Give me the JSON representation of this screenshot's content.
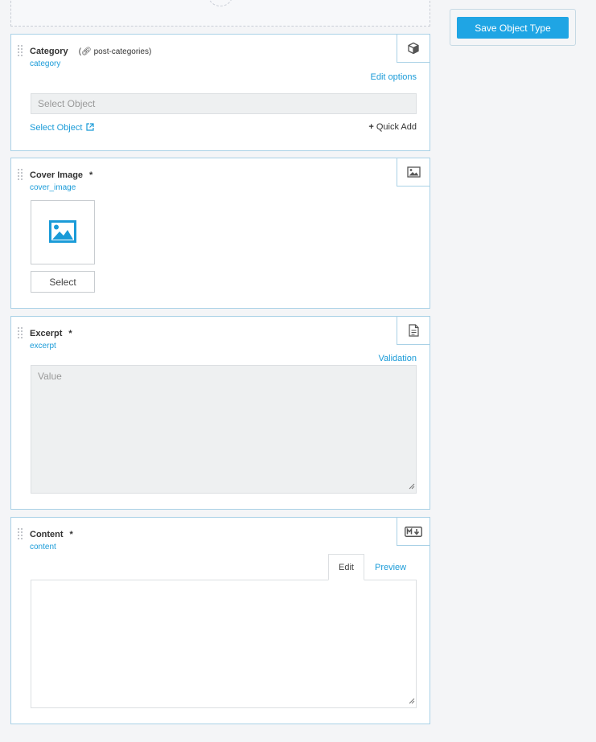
{
  "sidebar": {
    "save_label": "Save Object Type"
  },
  "fields": {
    "category": {
      "name": "Category",
      "meta": "post-categories",
      "slug": "category",
      "edit_options": "Edit options",
      "placeholder": "Select Object",
      "select_link": "Select Object",
      "quick_add": "Quick Add",
      "type_icon": "cube-icon"
    },
    "cover_image": {
      "name": "Cover Image",
      "required": "*",
      "slug": "cover_image",
      "select_label": "Select",
      "type_icon": "image-icon"
    },
    "excerpt": {
      "name": "Excerpt",
      "required": "*",
      "slug": "excerpt",
      "validation": "Validation",
      "placeholder": "Value",
      "type_icon": "document-icon"
    },
    "content": {
      "name": "Content",
      "required": "*",
      "slug": "content",
      "tab_edit": "Edit",
      "tab_preview": "Preview",
      "active_tab": "Edit",
      "type_icon": "markdown-icon"
    }
  },
  "colors": {
    "accent": "#1fa5e4",
    "link": "#1a9bd8",
    "field_border": "#a9d1e6"
  }
}
